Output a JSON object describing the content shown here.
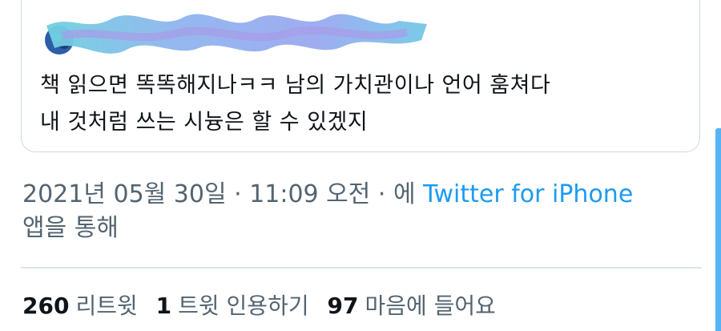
{
  "quoted_tweet": {
    "text_line_1": "책 읽으면 똑똑해지나ㅋㅋ 남의 가치관이나 언어 훔쳐다",
    "text_line_2": "내 것처럼 쓰는 시늉은 할 수 있겠지"
  },
  "meta": {
    "date": "2021년 05월 30일",
    "separator_1": " · ",
    "time": "11:09 오전",
    "separator_2": " · ",
    "via_prefix": "에 ",
    "source": "Twitter for iPhone",
    "via_suffix": "앱을 통해"
  },
  "stats": {
    "retweets_count": "260",
    "retweets_label": "리트윗",
    "quotes_count": "1",
    "quotes_label": "트윗 인용하기",
    "likes_count": "97",
    "likes_label": "마음에 들어요"
  },
  "colors": {
    "link": "#1d9bf0",
    "muted_text": "#536471",
    "main_text": "#0f1419",
    "redaction_mark": "#7fb6e6"
  },
  "icons": {
    "avatar": "avatar-icon",
    "redaction": "redaction-scribble"
  }
}
